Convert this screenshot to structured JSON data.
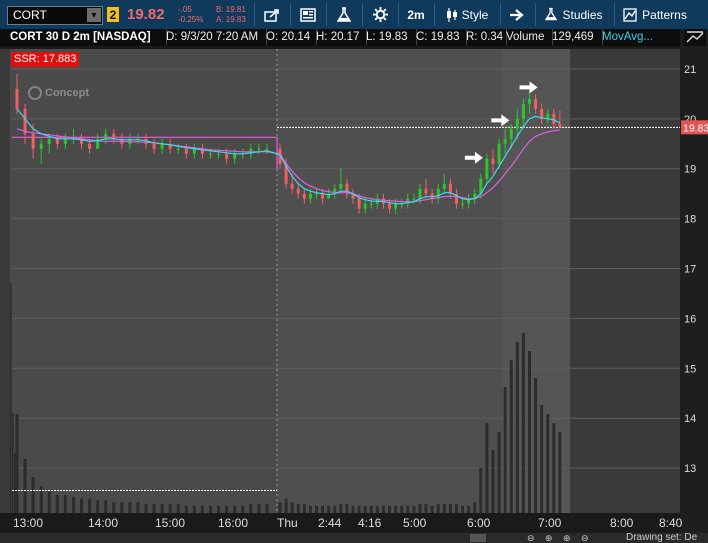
{
  "toolbar": {
    "symbol": "CORT",
    "link_badge": "2",
    "last_price": "19.82",
    "change": "-.05",
    "change_pct": "-0.25%",
    "bid": "B: 19.81",
    "ask": "A: 19.83",
    "interval": "2m",
    "style_label": "Style",
    "studies_label": "Studies",
    "patterns_label": "Patterns"
  },
  "header": {
    "title": "CORT 30 D 2m [NASDAQ]",
    "date": "D: 9/3/20 7:20 AM",
    "open": "O: 20.14",
    "high": "H: 20.17",
    "low": "L: 19.83",
    "close": "C: 19.83",
    "range": "R: 0.34",
    "volume_label": "Volume",
    "volume_value": "129,469",
    "movavg_label": "MovAvg..."
  },
  "ssr_label": "SSR: 17.883",
  "watermark": "Concept",
  "status": {
    "drawing_set": "Drawing set: De"
  },
  "colors": {
    "up": "#2ec42e",
    "down": "#f06060",
    "ma_fast": "#40d8f0",
    "ma_slow": "#e060e0",
    "price_label_bg": "#e05555",
    "ssr_bg": "#e01010"
  },
  "chart_data": {
    "type": "candlestick",
    "y_axis": {
      "ticks": [
        13,
        14,
        15,
        16,
        17,
        18,
        19,
        20,
        21
      ],
      "ylim": [
        12.1,
        21.4
      ]
    },
    "x_axis": {
      "ticks": [
        "13:00",
        "14:00",
        "15:00",
        "16:00",
        "Thu",
        "2:44",
        "4:16",
        "5:00",
        "6:00",
        "7:00",
        "8:00",
        "8:40"
      ]
    },
    "current_price": 19.83,
    "current_price_label": "19.83",
    "ssr_level": 17.883,
    "prior_close_level": 19.63,
    "session_split_label": "Thu",
    "candles": [
      [
        20.6,
        20.9,
        20.1,
        20.2
      ],
      [
        20.2,
        20.3,
        19.5,
        19.7
      ],
      [
        19.7,
        19.9,
        19.2,
        19.4
      ],
      [
        19.4,
        19.6,
        19.1,
        19.5
      ],
      [
        19.5,
        19.7,
        19.3,
        19.6
      ],
      [
        19.6,
        19.7,
        19.4,
        19.5
      ],
      [
        19.5,
        19.7,
        19.4,
        19.6
      ],
      [
        19.6,
        19.8,
        19.5,
        19.6
      ],
      [
        19.6,
        19.7,
        19.4,
        19.5
      ],
      [
        19.5,
        19.6,
        19.3,
        19.4
      ],
      [
        19.4,
        19.7,
        19.4,
        19.6
      ],
      [
        19.6,
        19.8,
        19.5,
        19.7
      ],
      [
        19.7,
        19.8,
        19.5,
        19.6
      ],
      [
        19.6,
        19.7,
        19.4,
        19.5
      ],
      [
        19.5,
        19.7,
        19.4,
        19.6
      ],
      [
        19.6,
        19.7,
        19.5,
        19.6
      ],
      [
        19.6,
        19.7,
        19.4,
        19.5
      ],
      [
        19.5,
        19.6,
        19.3,
        19.4
      ],
      [
        19.4,
        19.6,
        19.3,
        19.5
      ],
      [
        19.5,
        19.6,
        19.3,
        19.4
      ],
      [
        19.4,
        19.5,
        19.3,
        19.4
      ],
      [
        19.4,
        19.5,
        19.2,
        19.3
      ],
      [
        19.3,
        19.5,
        19.2,
        19.4
      ],
      [
        19.4,
        19.5,
        19.2,
        19.3
      ],
      [
        19.3,
        19.4,
        19.2,
        19.3
      ],
      [
        19.3,
        19.4,
        19.2,
        19.3
      ],
      [
        19.3,
        19.4,
        19.1,
        19.2
      ],
      [
        19.2,
        19.4,
        19.1,
        19.3
      ],
      [
        19.3,
        19.4,
        19.2,
        19.3
      ],
      [
        19.3,
        19.5,
        19.2,
        19.4
      ],
      [
        19.4,
        19.5,
        19.3,
        19.4
      ],
      [
        19.4,
        19.5,
        19.3,
        19.4
      ],
      [
        19.4,
        19.5,
        19.0,
        19.1
      ],
      [
        19.1,
        19.2,
        18.6,
        18.7
      ],
      [
        18.7,
        18.9,
        18.5,
        18.6
      ],
      [
        18.6,
        18.7,
        18.4,
        18.5
      ],
      [
        18.5,
        18.6,
        18.3,
        18.4
      ],
      [
        18.4,
        18.6,
        18.3,
        18.5
      ],
      [
        18.5,
        18.6,
        18.4,
        18.5
      ],
      [
        18.5,
        18.6,
        18.3,
        18.4
      ],
      [
        18.4,
        18.6,
        18.4,
        18.5
      ],
      [
        18.5,
        18.7,
        18.4,
        18.6
      ],
      [
        18.6,
        19.0,
        18.5,
        18.7
      ],
      [
        18.7,
        18.8,
        18.4,
        18.5
      ],
      [
        18.5,
        18.6,
        18.3,
        18.4
      ],
      [
        18.4,
        18.5,
        18.1,
        18.2
      ],
      [
        18.2,
        18.4,
        18.1,
        18.3
      ],
      [
        18.3,
        18.4,
        18.2,
        18.3
      ],
      [
        18.3,
        18.5,
        18.2,
        18.4
      ],
      [
        18.4,
        18.5,
        18.2,
        18.3
      ],
      [
        18.3,
        18.4,
        18.1,
        18.2
      ],
      [
        18.2,
        18.4,
        18.1,
        18.3
      ],
      [
        18.3,
        18.4,
        18.2,
        18.3
      ],
      [
        18.3,
        18.5,
        18.2,
        18.4
      ],
      [
        18.4,
        18.5,
        18.3,
        18.4
      ],
      [
        18.4,
        18.7,
        18.3,
        18.6
      ],
      [
        18.6,
        18.8,
        18.4,
        18.5
      ],
      [
        18.5,
        18.6,
        18.3,
        18.4
      ],
      [
        18.4,
        18.7,
        18.3,
        18.6
      ],
      [
        18.6,
        18.9,
        18.5,
        18.7
      ],
      [
        18.7,
        18.8,
        18.4,
        18.5
      ],
      [
        18.5,
        18.6,
        18.2,
        18.3
      ],
      [
        18.3,
        18.4,
        18.2,
        18.3
      ],
      [
        18.3,
        18.5,
        18.2,
        18.4
      ],
      [
        18.4,
        18.6,
        18.3,
        18.5
      ],
      [
        18.5,
        18.9,
        18.4,
        18.8
      ],
      [
        18.8,
        19.3,
        18.7,
        19.2
      ],
      [
        19.2,
        19.4,
        18.9,
        19.1
      ],
      [
        19.1,
        19.6,
        19.0,
        19.5
      ],
      [
        19.5,
        19.8,
        19.3,
        19.6
      ],
      [
        19.6,
        19.9,
        19.4,
        19.8
      ],
      [
        19.8,
        20.2,
        19.6,
        20.0
      ],
      [
        20.0,
        20.4,
        19.8,
        20.3
      ],
      [
        20.3,
        20.6,
        20.1,
        20.4
      ],
      [
        20.4,
        20.5,
        20.1,
        20.2
      ],
      [
        20.2,
        20.3,
        19.9,
        20.0
      ],
      [
        20.0,
        20.2,
        19.9,
        20.1
      ],
      [
        20.1,
        20.2,
        19.8,
        19.9
      ],
      [
        19.9,
        20.17,
        19.83,
        19.83
      ]
    ],
    "ma_fast": [
      20.2,
      20.0,
      19.8,
      19.7,
      19.65,
      19.6,
      19.6,
      19.6,
      19.58,
      19.55,
      19.56,
      19.6,
      19.6,
      19.58,
      19.58,
      19.58,
      19.56,
      19.52,
      19.5,
      19.48,
      19.45,
      19.42,
      19.4,
      19.38,
      19.36,
      19.34,
      19.32,
      19.3,
      19.3,
      19.32,
      19.34,
      19.36,
      19.28,
      19.05,
      18.85,
      18.7,
      18.6,
      18.55,
      18.52,
      18.5,
      18.48,
      18.5,
      18.55,
      18.55,
      18.5,
      18.42,
      18.38,
      18.35,
      18.35,
      18.34,
      18.32,
      18.3,
      18.3,
      18.32,
      18.34,
      18.4,
      18.44,
      18.44,
      18.46,
      18.52,
      18.52,
      18.46,
      18.4,
      18.38,
      18.4,
      18.5,
      18.7,
      18.85,
      19.05,
      19.25,
      19.45,
      19.65,
      19.85,
      20.0,
      20.05,
      20.02,
      20.0,
      19.98,
      19.92
    ],
    "ma_slow": [
      19.8,
      19.75,
      19.72,
      19.7,
      19.68,
      19.66,
      19.64,
      19.62,
      19.6,
      19.58,
      19.56,
      19.55,
      19.55,
      19.55,
      19.54,
      19.54,
      19.53,
      19.52,
      19.5,
      19.48,
      19.46,
      19.44,
      19.42,
      19.4,
      19.38,
      19.37,
      19.36,
      19.35,
      19.34,
      19.34,
      19.34,
      19.34,
      19.3,
      19.1,
      18.95,
      18.82,
      18.72,
      18.65,
      18.6,
      18.56,
      18.54,
      18.52,
      18.52,
      18.52,
      18.5,
      18.46,
      18.42,
      18.4,
      18.38,
      18.37,
      18.36,
      18.35,
      18.34,
      18.34,
      18.34,
      18.36,
      18.38,
      18.4,
      18.42,
      18.44,
      18.45,
      18.44,
      18.42,
      18.4,
      18.4,
      18.44,
      18.52,
      18.62,
      18.75,
      18.9,
      19.05,
      19.22,
      19.4,
      19.55,
      19.65,
      19.7,
      19.74,
      19.76,
      19.78
    ],
    "volume_profile": [
      0.55,
      0.3,
      0.2,
      0.15,
      0.12,
      0.1,
      0.1,
      0.09,
      0.08,
      0.08,
      0.07,
      0.07,
      0.06,
      0.06,
      0.06,
      0.06,
      0.05,
      0.05,
      0.05,
      0.05,
      0.05,
      0.04,
      0.04,
      0.04,
      0.04,
      0.04,
      0.04,
      0.04,
      0.04,
      0.05,
      0.05,
      0.05,
      0.06,
      0.08,
      0.06,
      0.05,
      0.05,
      0.04,
      0.04,
      0.04,
      0.04,
      0.04,
      0.05,
      0.05,
      0.04,
      0.04,
      0.04,
      0.04,
      0.04,
      0.04,
      0.04,
      0.04,
      0.04,
      0.04,
      0.04,
      0.05,
      0.05,
      0.04,
      0.05,
      0.05,
      0.05,
      0.05,
      0.04,
      0.04,
      0.06,
      0.25,
      0.5,
      0.35,
      0.45,
      0.7,
      0.85,
      0.95,
      1.0,
      0.9,
      0.75,
      0.6,
      0.55,
      0.5,
      0.45
    ],
    "annotations": [
      "arrow",
      "arrow",
      "arrow"
    ]
  }
}
